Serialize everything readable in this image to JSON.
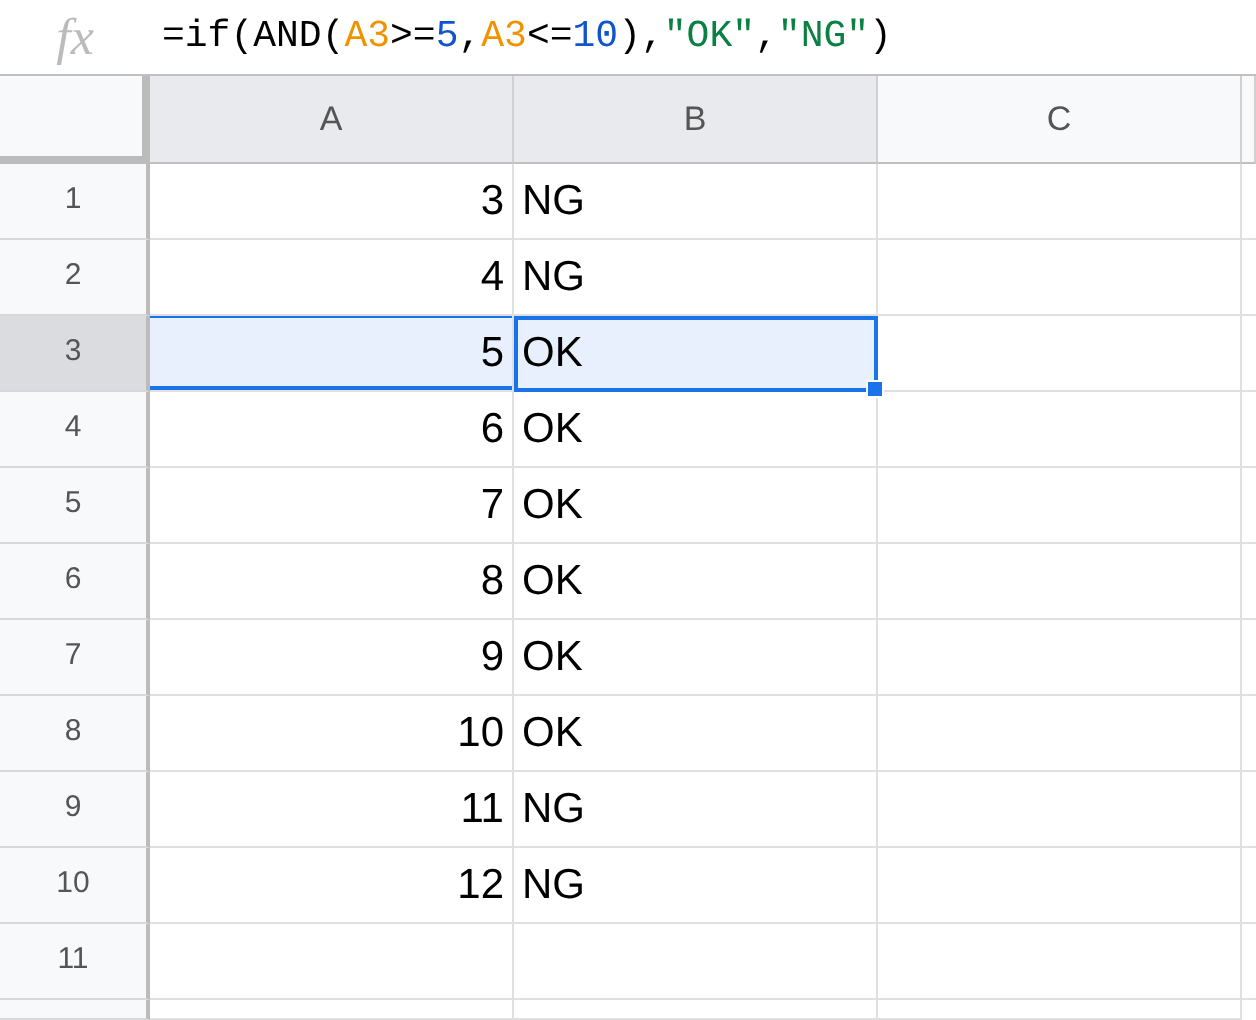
{
  "formula_bar": {
    "icon_text": "fx",
    "tokens": [
      {
        "kind": "plain",
        "text": "=if(AND("
      },
      {
        "kind": "ref",
        "text": "A3"
      },
      {
        "kind": "plain",
        "text": ">="
      },
      {
        "kind": "number",
        "text": "5"
      },
      {
        "kind": "plain",
        "text": ","
      },
      {
        "kind": "ref",
        "text": "A3"
      },
      {
        "kind": "plain",
        "text": "<="
      },
      {
        "kind": "number",
        "text": "10"
      },
      {
        "kind": "plain",
        "text": "),"
      },
      {
        "kind": "string",
        "text": "\"OK\""
      },
      {
        "kind": "plain",
        "text": ","
      },
      {
        "kind": "string",
        "text": "\"NG\""
      },
      {
        "kind": "plain",
        "text": ")"
      }
    ]
  },
  "columns": [
    {
      "label": "A",
      "selected": true
    },
    {
      "label": "B",
      "selected": true
    },
    {
      "label": "C",
      "selected": false
    }
  ],
  "rows": [
    {
      "label": "1",
      "selected": false,
      "cells": [
        {
          "text": "3",
          "active": false
        },
        {
          "text": "NG",
          "active": false
        }
      ]
    },
    {
      "label": "2",
      "selected": false,
      "cells": [
        {
          "text": "4",
          "active": false
        },
        {
          "text": "NG",
          "active": false
        }
      ]
    },
    {
      "label": "3",
      "selected": true,
      "cells": [
        {
          "text": "5",
          "active": false
        },
        {
          "text": "OK",
          "active": true
        }
      ]
    },
    {
      "label": "4",
      "selected": false,
      "cells": [
        {
          "text": "6",
          "active": false
        },
        {
          "text": "OK",
          "active": false
        }
      ]
    },
    {
      "label": "5",
      "selected": false,
      "cells": [
        {
          "text": "7",
          "active": false
        },
        {
          "text": "OK",
          "active": false
        }
      ]
    },
    {
      "label": "6",
      "selected": false,
      "cells": [
        {
          "text": "8",
          "active": false
        },
        {
          "text": "OK",
          "active": false
        }
      ]
    },
    {
      "label": "7",
      "selected": false,
      "cells": [
        {
          "text": "9",
          "active": false
        },
        {
          "text": "OK",
          "active": false
        }
      ]
    },
    {
      "label": "8",
      "selected": false,
      "cells": [
        {
          "text": "10",
          "active": false
        },
        {
          "text": "OK",
          "active": false
        }
      ]
    },
    {
      "label": "9",
      "selected": false,
      "cells": [
        {
          "text": "11",
          "active": false
        },
        {
          "text": "NG",
          "active": false
        }
      ]
    },
    {
      "label": "10",
      "selected": false,
      "cells": [
        {
          "text": "12",
          "active": false
        },
        {
          "text": "NG",
          "active": false
        }
      ]
    },
    {
      "label": "11",
      "selected": false
    }
  ]
}
